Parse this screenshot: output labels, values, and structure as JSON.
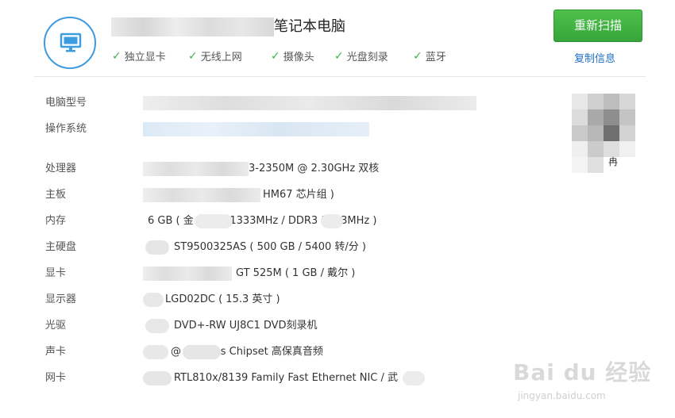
{
  "header": {
    "title_suffix": "笔记本电脑",
    "features": [
      "独立显卡",
      "无线上网",
      "摄像头",
      "光盘刻录",
      "蓝牙"
    ],
    "check_glyph": "✓",
    "rescan_label": "重新扫描",
    "copy_label": "复制信息"
  },
  "sidebar": {
    "qr_partial_char": "冉"
  },
  "specs": [
    {
      "label": "电脑型号",
      "value": ""
    },
    {
      "label": "操作系统",
      "value": ""
    },
    {
      "label": "处理器",
      "value": "3-2350M @ 2.30GHz 双核"
    },
    {
      "label": "主板",
      "value": "HM67 芯片组 )"
    },
    {
      "label": "内存",
      "value": "6 GB ( 金 DDR3 1333MHz / DDR3 1333MHz )"
    },
    {
      "label": "主硬盘",
      "value": "ST9500325AS ( 500 GB / 5400 转/分 )"
    },
    {
      "label": "显卡",
      "value": "GT 525M ( 1 GB / 戴尔 )"
    },
    {
      "label": "显示器",
      "value": "LGD02DC ( 15.3 英寸 )"
    },
    {
      "label": "光驱",
      "value": "DVD+-RW UJ8C1 DVD刻录机"
    },
    {
      "label": "声卡",
      "value": "@ 6 Series Chipset 高保真音频"
    },
    {
      "label": "网卡",
      "value": "RTL810x/8139 Family Fast Ethernet NIC / 武"
    }
  ],
  "watermark": {
    "main": "Bai du 经验",
    "url": "jingyan.baidu.com"
  },
  "colors": {
    "accent_blue": "#3d9be0",
    "button_green": "#3bb54a",
    "link_blue": "#1f6fc5"
  },
  "icons": {
    "logo": "monitor-icon",
    "feature": "check-icon"
  }
}
